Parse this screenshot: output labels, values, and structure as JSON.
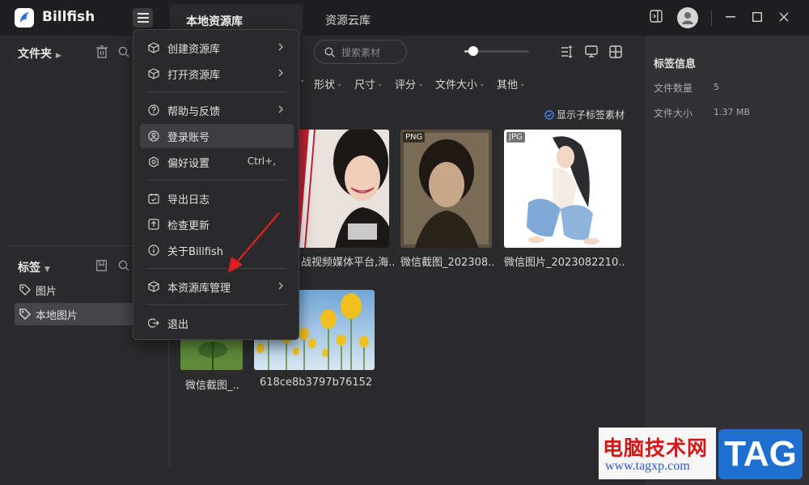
{
  "app": {
    "title": "Billfish"
  },
  "tabs": {
    "local": "本地资源库",
    "cloud": "资源云库"
  },
  "sidebar": {
    "folder_header": "文件夹",
    "tag_header": "标签",
    "tags": [
      {
        "label": "图片",
        "selected": false
      },
      {
        "label": "本地图片",
        "selected": true
      }
    ]
  },
  "toolbar": {
    "search_placeholder": "搜索素材",
    "filters": [
      "形状",
      "尺寸",
      "评分",
      "文件大小",
      "其他"
    ],
    "show_sub_tags": "显示子标签素材"
  },
  "menu": {
    "items": [
      {
        "label": "创建资源库",
        "icon": "cube-icon",
        "submenu": true
      },
      {
        "label": "打开资源库",
        "icon": "cube-icon",
        "submenu": true
      },
      {
        "label": "帮助与反馈",
        "icon": "help-icon",
        "submenu": true
      },
      {
        "label": "登录账号",
        "icon": "user-icon",
        "submenu": false,
        "highlighted": true
      },
      {
        "label": "偏好设置",
        "icon": "settings-icon",
        "submenu": false,
        "shortcut": "Ctrl+,"
      },
      {
        "label": "导出日志",
        "icon": "calendar-icon",
        "submenu": false
      },
      {
        "label": "检查更新",
        "icon": "update-icon",
        "submenu": false
      },
      {
        "label": "关于Billfish",
        "icon": "info-icon",
        "submenu": false
      },
      {
        "label": "本资源库管理",
        "icon": "cube-icon",
        "submenu": true
      },
      {
        "label": "退出",
        "icon": "exit-icon",
        "submenu": false
      }
    ]
  },
  "assets": [
    {
      "caption": "战视频媒体平台,海..",
      "badge": ""
    },
    {
      "caption": "微信截图_202308..",
      "badge": "PNG"
    },
    {
      "caption": "微信图片_2023082210..",
      "badge": "JPG"
    },
    {
      "caption": "微信截图_..",
      "badge": ""
    },
    {
      "caption": "618ce8b3797b76152",
      "badge": ""
    }
  ],
  "info_panel": {
    "title": "标签信息",
    "file_count_label": "文件数量",
    "file_count": "5",
    "file_size_label": "文件大小",
    "file_size": "1.37 MB"
  },
  "watermark": {
    "site_name": "电脑技术网",
    "url": "www.tagxp.com",
    "tag": "TAG"
  },
  "colors": {
    "accent": "#4a8cff",
    "arrow": "#e02020",
    "menu_bg": "#2a2a2c"
  }
}
